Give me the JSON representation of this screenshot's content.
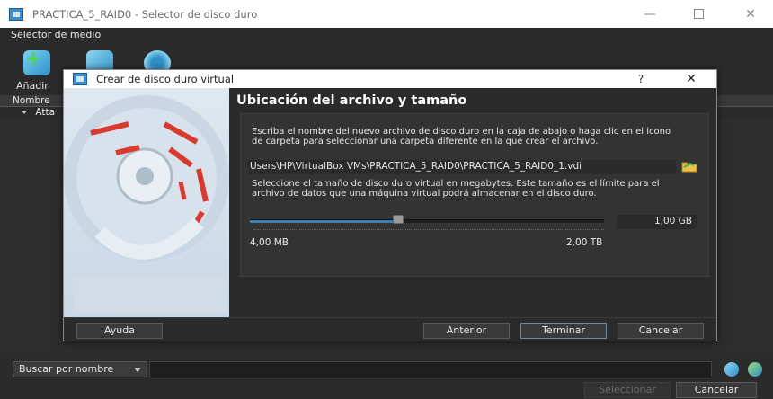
{
  "window": {
    "title": "PRACTICA_5_RAID0 - Selector de disco duro",
    "minimize": "—",
    "close": "✕"
  },
  "menu": {
    "label": "Selector de medio"
  },
  "toolbar": {
    "add_label": "Añadir"
  },
  "tree": {
    "column_name": "Nombre",
    "group_label": "Atta"
  },
  "search": {
    "mode": "Buscar por nombre"
  },
  "buttons": {
    "select": "Seleccionar",
    "cancel": "Cancelar"
  },
  "dialog": {
    "title": "Crear de disco duro virtual",
    "help": "?",
    "close": "✕",
    "heading": "Ubicación del archivo y tamaño",
    "description_location": "Escriba el nombre del nuevo archivo de disco duro en la caja de abajo o haga clic en el icono de carpeta para seleccionar una carpeta diferente en la que crear el archivo.",
    "file_path": "Users\\HP\\VirtualBox VMs\\PRACTICA_5_RAID0\\PRACTICA_5_RAID0_1.vdi",
    "description_size": "Seleccione el tamaño de disco duro virtual en megabytes. Este tamaño es el límite para el archivo de datos que una máquina virtual podrá almacenar en el disco duro.",
    "size_value": "1,00 GB",
    "slider_position": 0.42,
    "min_label": "4,00 MB",
    "max_label": "2,00 TB",
    "buttons": {
      "help": "Ayuda",
      "back": "Anterior",
      "finish": "Terminar",
      "cancel": "Cancelar"
    }
  },
  "colors": {
    "accent": "#3f7fb0",
    "background": "#2b2b2b",
    "side_panel": "#dfe8f0",
    "disk_red": "#d93a2f"
  }
}
